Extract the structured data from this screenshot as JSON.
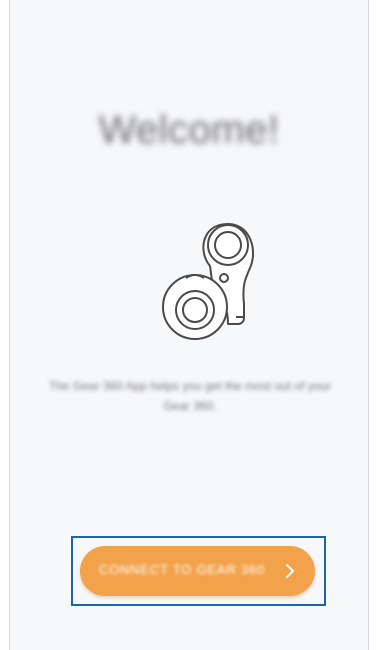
{
  "welcome": {
    "title": "Welcome!",
    "description": "The Gear 360 App helps you get the most out of your Gear 360."
  },
  "connect_button": {
    "label": "CONNECT TO GEAR 360"
  },
  "icons": {
    "device": "gear-360-camera-icon",
    "chevron": "chevron-right-icon"
  },
  "colors": {
    "accent": "#f2a24a",
    "highlight": "#1c66ad",
    "background": "#f7f8fa"
  }
}
